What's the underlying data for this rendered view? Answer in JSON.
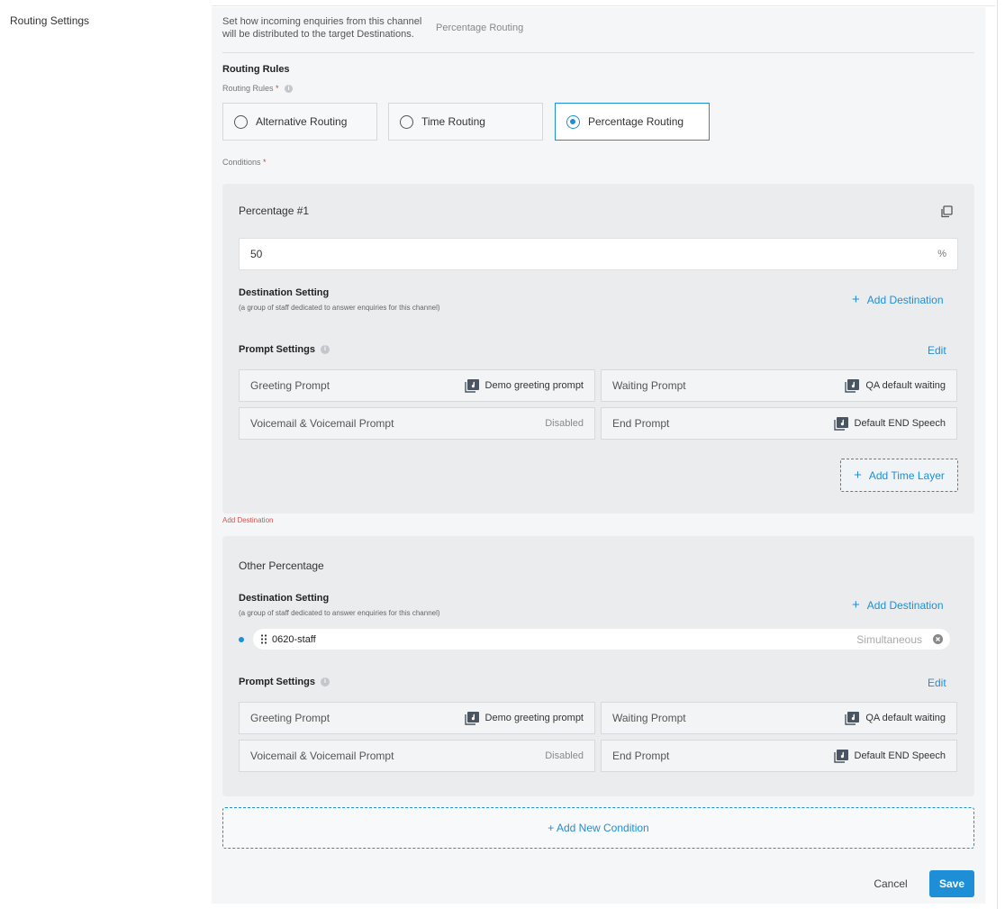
{
  "section": {
    "label": "Routing Settings"
  },
  "routing": {
    "description": "Set how incoming enquiries from this channel will be distributed to the target Destinations.",
    "current_value": "Percentage Routing",
    "rules_heading": "Routing Rules",
    "rules_label": "Routing Rules",
    "required_mark": "*",
    "options": [
      {
        "label": "Alternative Routing",
        "selected": false
      },
      {
        "label": "Time Routing",
        "selected": false
      },
      {
        "label": "Percentage Routing",
        "selected": true
      }
    ],
    "conditions_label": "Conditions"
  },
  "card1": {
    "title": "Percentage #1",
    "percentage_value": "50",
    "percentage_unit": "%",
    "destination_title": "Destination Setting",
    "destination_sub": "(a group of staff dedicated to answer enquiries for this channel)",
    "add_destination": "Add Destination",
    "prompt_title": "Prompt Settings",
    "edit": "Edit",
    "prompts": [
      {
        "label": "Greeting Prompt",
        "value": "Demo greeting prompt",
        "icon": "music-library-icon"
      },
      {
        "label": "Waiting Prompt",
        "value": "QA default waiting",
        "icon": "music-library-icon"
      },
      {
        "label": "Voicemail & Voicemail Prompt",
        "value": "Disabled",
        "icon": ""
      },
      {
        "label": "End Prompt",
        "value": "Default END Speech",
        "icon": "music-library-icon"
      }
    ],
    "add_time_layer": "Add Time Layer"
  },
  "error_text": "Add Destination",
  "card2": {
    "title": "Other Percentage",
    "destination_title": "Destination Setting",
    "destination_sub": "(a group of staff dedicated to answer enquiries for this channel)",
    "add_destination": "Add Destination",
    "staff": {
      "name": "0620-staff",
      "mode": "Simultaneous"
    },
    "prompt_title": "Prompt Settings",
    "edit": "Edit",
    "prompts": [
      {
        "label": "Greeting Prompt",
        "value": "Demo greeting prompt",
        "icon": "music-library-icon"
      },
      {
        "label": "Waiting Prompt",
        "value": "QA default waiting",
        "icon": "music-library-icon"
      },
      {
        "label": "Voicemail & Voicemail Prompt",
        "value": "Disabled",
        "icon": ""
      },
      {
        "label": "End Prompt",
        "value": "Default END Speech",
        "icon": "music-library-icon"
      }
    ]
  },
  "add_new_condition": "+ Add New Condition",
  "actions": {
    "cancel": "Cancel",
    "save": "Save"
  },
  "colors": {
    "accent": "#1e8fd6",
    "error": "#d9534f",
    "required": "#e53935"
  }
}
